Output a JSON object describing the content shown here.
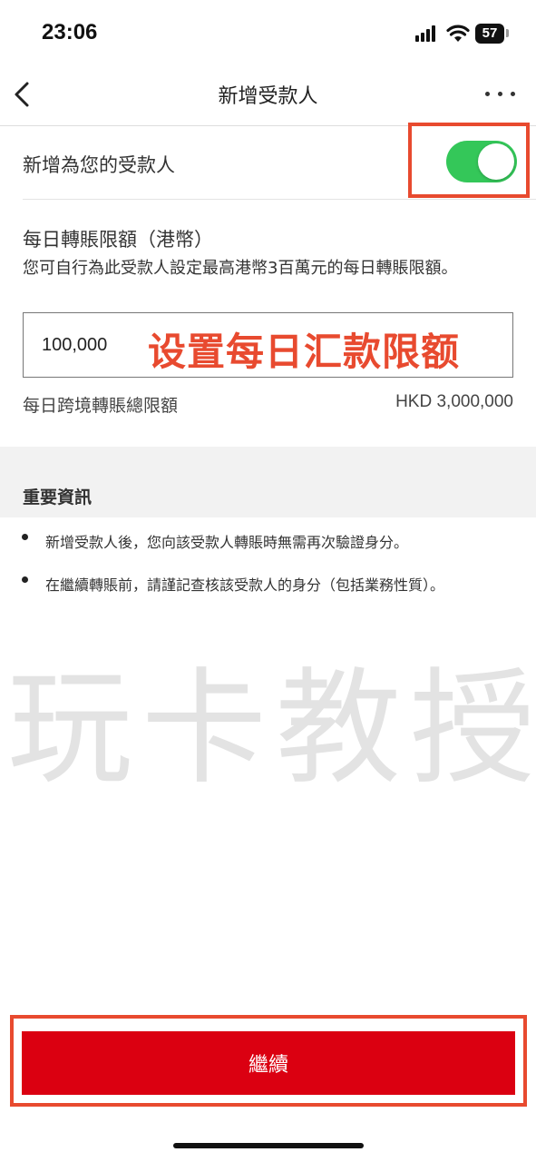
{
  "status_bar": {
    "time": "23:06",
    "battery": "57",
    "icons": [
      "signal-icon",
      "wifi-icon",
      "battery-icon"
    ]
  },
  "nav": {
    "title": "新增受款人",
    "back_icon": "chevron-left-icon",
    "more_icon": "more-dots-icon"
  },
  "payee_toggle": {
    "label": "新增為您的受款人",
    "checked": true,
    "color": "#34c759"
  },
  "daily_limit": {
    "title": "每日轉賬限額（港幣）",
    "description": "您可自行為此受款人設定最高港幣3百萬元的每日轉賬限額。",
    "amount_value": "100,000",
    "annotation": "设置每日汇款限额",
    "annotation_color": "#e84a2f"
  },
  "cross_border": {
    "label": "每日跨境轉賬總限額",
    "value": "HKD 3,000,000"
  },
  "important_info": {
    "title": "重要資訊",
    "items": [
      "新增受款人後，您向該受款人轉賬時無需再次驗證身分。",
      "在繼續轉賬前，請謹記查核該受款人的身分（包括業務性質）。"
    ]
  },
  "watermark": "玩卡教授",
  "continue_button": {
    "label": "繼續",
    "color": "#db0011"
  },
  "highlight_color": "#e84a2f"
}
